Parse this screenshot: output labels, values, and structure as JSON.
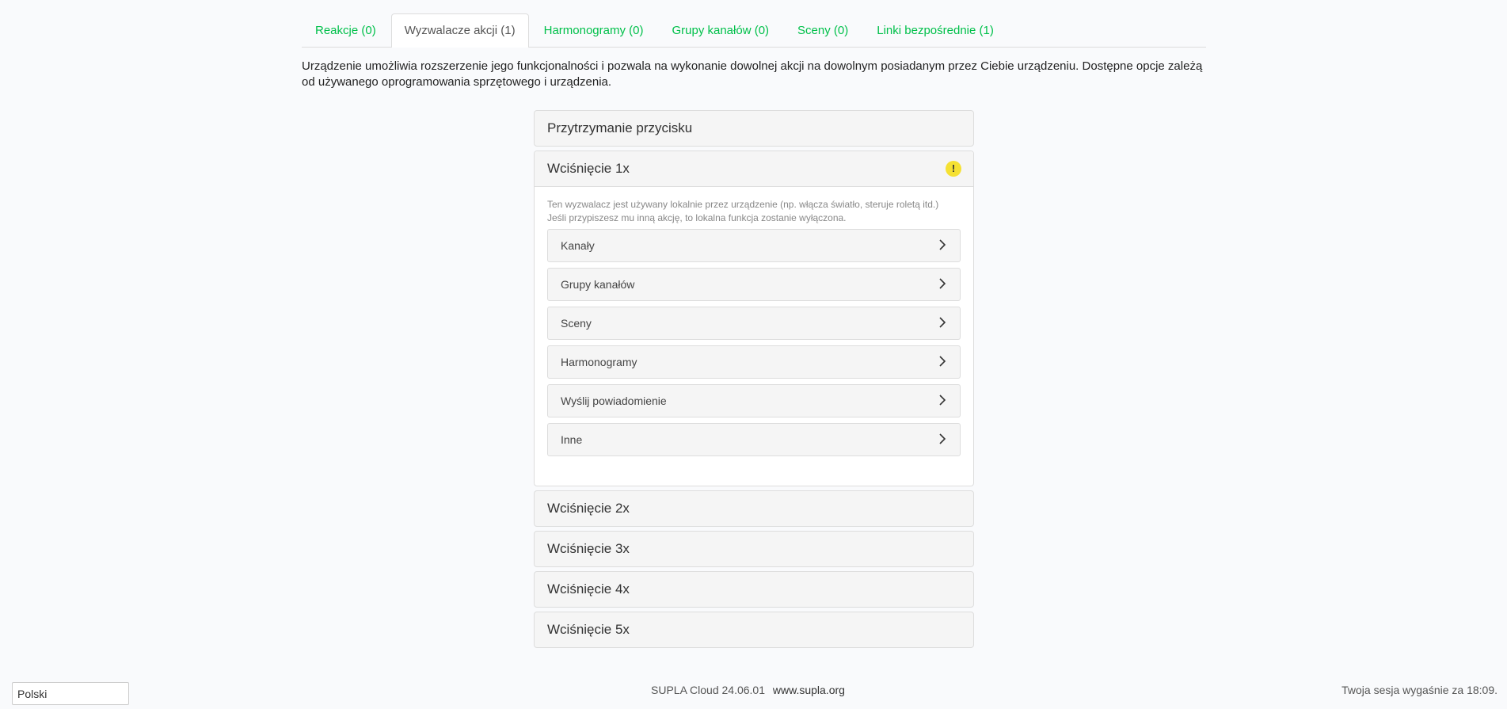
{
  "tabs": [
    {
      "label": "Reakcje (0)"
    },
    {
      "label": "Wyzwalacze akcji (1)"
    },
    {
      "label": "Harmonogramy (0)"
    },
    {
      "label": "Grupy kanałów (0)"
    },
    {
      "label": "Sceny (0)"
    },
    {
      "label": "Linki bezpośrednie (1)"
    }
  ],
  "description": "Urządzenie umożliwia rozszerzenie jego funkcjonalności i pozwala na wykonanie dowolnej akcji na dowolnym posiadanym przez Ciebie urządzeniu. Dostępne opcje zależą od używanego oprogramowania sprzętowego i urządzenia.",
  "panels": [
    {
      "title": "Przytrzymanie przycisku"
    },
    {
      "title": "Wciśnięcie 1x",
      "warning_icon": "exclamation-icon",
      "warning_color": "#f5e133"
    },
    {
      "title": "Wciśnięcie 2x"
    },
    {
      "title": "Wciśnięcie 3x"
    },
    {
      "title": "Wciśnięcie 4x"
    },
    {
      "title": "Wciśnięcie 5x"
    }
  ],
  "open_panel": {
    "note_line1": "Ten wyzwalacz jest używany lokalnie przez urządzenie (np. włącza światło, steruje roletą itd.)",
    "note_line2": "Jeśli przypiszesz mu inną akcję, to lokalna funkcja zostanie wyłączona.",
    "options": [
      {
        "label": "Kanały"
      },
      {
        "label": "Grupy kanałów"
      },
      {
        "label": "Sceny"
      },
      {
        "label": "Harmonogramy"
      },
      {
        "label": "Wyślij powiadomienie"
      },
      {
        "label": "Inne"
      }
    ]
  },
  "footer": {
    "language": "Polski",
    "version": "SUPLA Cloud 24.06.01",
    "link": "www.supla.org",
    "session": "Twoja sesja wygaśnie za 18:09."
  },
  "colors": {
    "accent": "#00c04a",
    "background": "#f9fafc"
  }
}
